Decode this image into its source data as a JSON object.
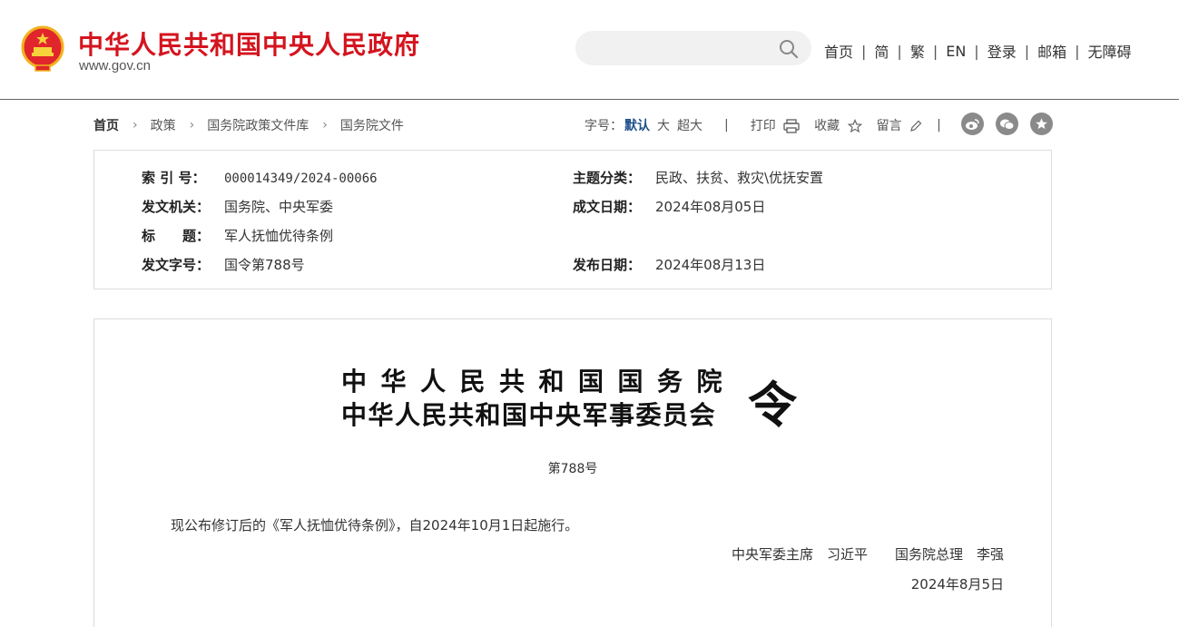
{
  "header": {
    "site_title": "中华人民共和国中央人民政府",
    "site_url": "www.gov.cn",
    "search_placeholder": "",
    "nav": [
      "首页",
      "简",
      "繁",
      "EN",
      "登录",
      "邮箱",
      "无障碍"
    ]
  },
  "breadcrumb": {
    "items": [
      "首页",
      "政策",
      "国务院政策文件库",
      "国务院文件"
    ]
  },
  "tools": {
    "font_size_label": "字号：",
    "font_sizes": [
      "默认",
      "大",
      "超大"
    ],
    "print": "打印",
    "favorite": "收藏",
    "comment": "留言"
  },
  "info": {
    "index_label": "索 引 号：",
    "index_value": "000014349/2024-00066",
    "topic_label": "主题分类：",
    "topic_value": "民政、扶贫、救灾\\优抚安置",
    "issuer_label": "发文机关：",
    "issuer_value": "国务院、中央军委",
    "created_label": "成文日期：",
    "created_value": "2024年08月05日",
    "title_label": "标　　题：",
    "title_value": "军人抚恤优待条例",
    "doc_no_label": "发文字号：",
    "doc_no_value": "国令第788号",
    "published_label": "发布日期：",
    "published_value": "2024年08月13日"
  },
  "document": {
    "issuer_line1": "中华人民共和国国务院",
    "issuer_line2": "中华人民共和国中央军事委员会",
    "order_char": "令",
    "order_number": "第788号",
    "body": "现公布修订后的《军人抚恤优待条例》，自2024年10月1日起施行。",
    "signers": "中央军委主席　习近平　　国务院总理　李强",
    "date": "2024年8月5日"
  },
  "colors": {
    "brand_red": "#d4141e",
    "active_blue": "#1f4f8b",
    "share_grey": "#8a8a8a"
  }
}
